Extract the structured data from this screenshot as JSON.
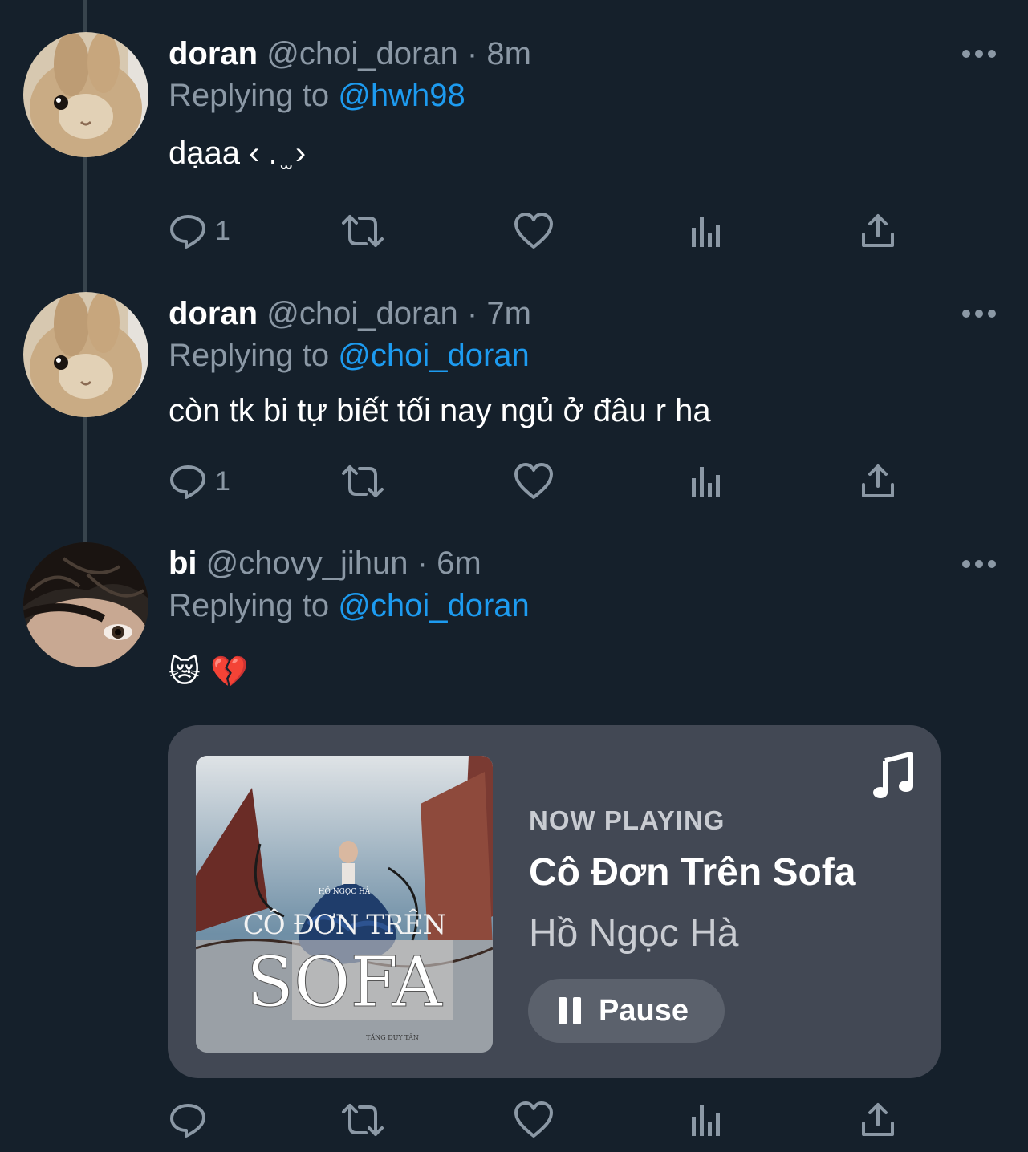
{
  "tweets": [
    {
      "name": "doran",
      "handle": "@choi_doran",
      "separator": "·",
      "time": "8m",
      "replying_prefix": "Replying to",
      "replying_to": "@hwh98",
      "text": "dạaa ‹ . ̫ ›",
      "reply_count": "1"
    },
    {
      "name": "doran",
      "handle": "@choi_doran",
      "separator": "·",
      "time": "7m",
      "replying_prefix": "Replying to",
      "replying_to": "@choi_doran",
      "text": "còn tk bi tự biết tối nay ngủ ở đâu r ha",
      "reply_count": "1"
    },
    {
      "name": "bi",
      "handle": "@chovy_jihun",
      "separator": "·",
      "time": "6m",
      "replying_prefix": "Replying to",
      "replying_to": "@choi_doran",
      "emoji": [
        "😿",
        "💔"
      ],
      "reply_count": ""
    }
  ],
  "now_playing": {
    "label": "NOW PLAYING",
    "title": "Cô Đơn Trên Sofa",
    "artist": "Hồ Ngọc Hà",
    "button_label": "Pause",
    "album_text_artist": "HỒ NGỌC HÀ",
    "album_text_title_1": "CÔ ĐƠN TRÊN",
    "album_text_title_2": "SOFA",
    "album_text_producer": "TĂNG DUY TÂN"
  },
  "icons": {
    "reply": "reply-icon",
    "retweet": "retweet-icon",
    "like": "heart-icon",
    "views": "views-icon",
    "share": "share-icon",
    "more": "more-icon",
    "music": "music-note-icon"
  },
  "colors": {
    "background": "#15202b",
    "mention": "#1d9bf0",
    "muted": "#8b98a5",
    "card": "#424854"
  }
}
